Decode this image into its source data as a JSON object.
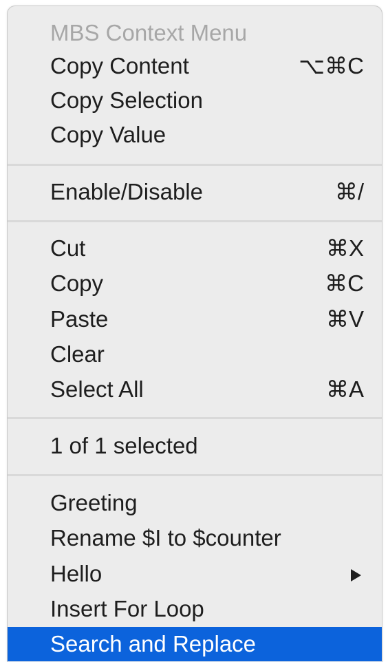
{
  "menu": {
    "header": "MBS Context Menu",
    "items": [
      {
        "label": "Copy Content",
        "shortcut": "⌥⌘C"
      },
      {
        "label": "Copy Selection",
        "shortcut": ""
      },
      {
        "label": "Copy Value",
        "shortcut": ""
      },
      {
        "label": "Enable/Disable",
        "shortcut": "⌘/"
      },
      {
        "label": "Cut",
        "shortcut": "⌘X"
      },
      {
        "label": "Copy",
        "shortcut": "⌘C"
      },
      {
        "label": "Paste",
        "shortcut": "⌘V"
      },
      {
        "label": "Clear",
        "shortcut": ""
      },
      {
        "label": "Select All",
        "shortcut": "⌘A"
      },
      {
        "label": "1 of 1 selected",
        "shortcut": ""
      },
      {
        "label": "Greeting",
        "shortcut": ""
      },
      {
        "label": "Rename $I to $counter",
        "shortcut": ""
      },
      {
        "label": "Hello",
        "shortcut": ""
      },
      {
        "label": "Insert For Loop",
        "shortcut": ""
      },
      {
        "label": "Search and Replace",
        "shortcut": ""
      }
    ],
    "submenu_icon": "triangle-right-icon",
    "selection_color": "#0c63dc"
  }
}
